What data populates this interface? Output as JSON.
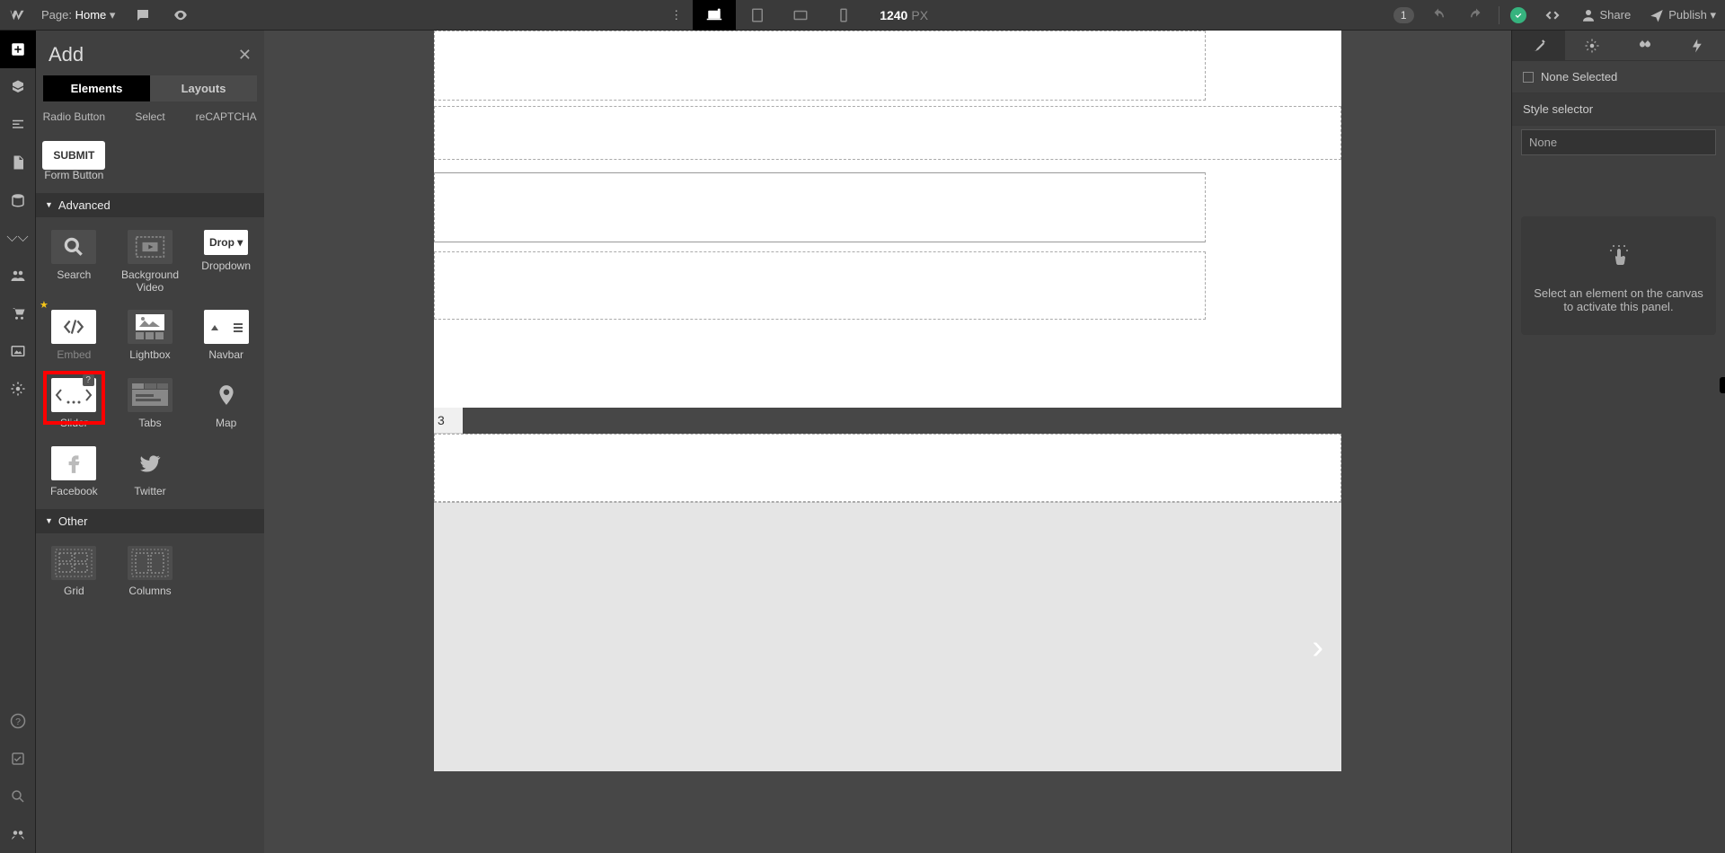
{
  "topbar": {
    "page_label": "Page:",
    "page_name": "Home",
    "canvas_width": "1240",
    "canvas_unit": "PX",
    "changes_badge": "1",
    "share_label": "Share",
    "publish_label": "Publish"
  },
  "add_panel": {
    "title": "Add",
    "tabs": {
      "elements": "Elements",
      "layouts": "Layouts"
    },
    "form_row": {
      "radio": "Radio Button",
      "select": "Select",
      "recaptcha": "reCAPTCHA"
    },
    "submit": {
      "chip": "SUBMIT",
      "label": "Form Button"
    },
    "sections": {
      "advanced": "Advanced",
      "other": "Other"
    },
    "advanced_items": {
      "search": "Search",
      "bgvideo": "Background Video",
      "dropdown": "Dropdown",
      "dropdown_chip": "Drop",
      "embed": "Embed",
      "lightbox": "Lightbox",
      "navbar": "Navbar",
      "slider": "Slider",
      "tabs": "Tabs",
      "map": "Map",
      "facebook": "Facebook",
      "twitter": "Twitter"
    },
    "other_items": {
      "grid": "Grid",
      "columns": "Columns"
    },
    "help_badge": "?"
  },
  "canvas": {
    "tab_label": "3"
  },
  "right_panel": {
    "none_selected": "None Selected",
    "style_selector_label": "Style selector",
    "style_selector_value": "None",
    "help_text_line1": "Select an element on the canvas",
    "help_text_line2": "to activate this panel."
  }
}
